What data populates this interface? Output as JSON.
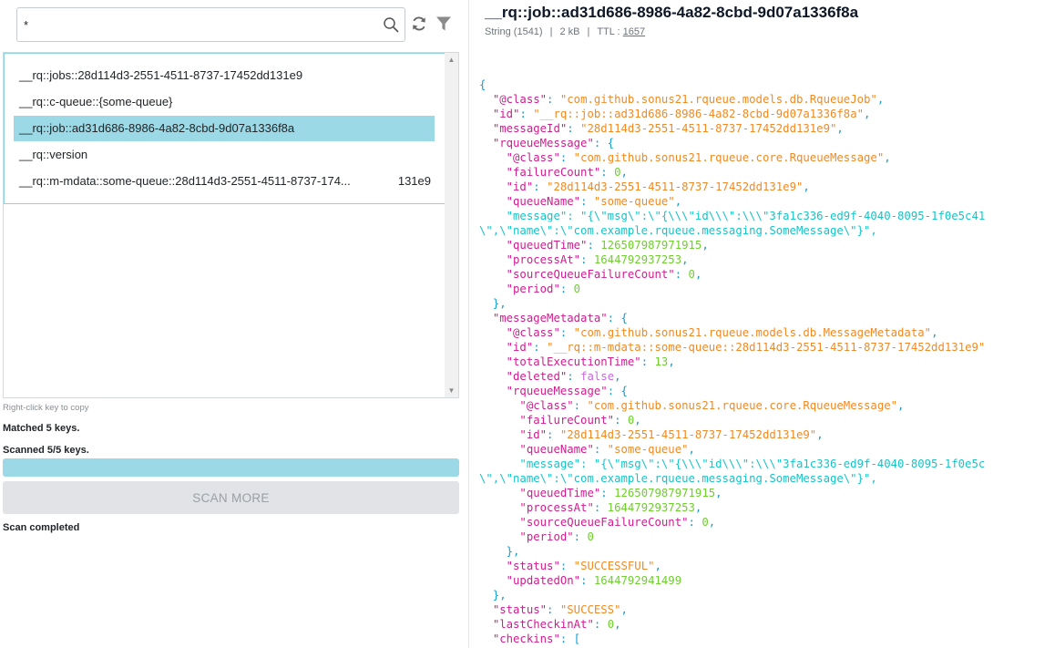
{
  "search": {
    "value": "*"
  },
  "keys": [
    {
      "label": "__rq::jobs::28d114d3-2551-4511-8737-17452dd131e9",
      "tail": "",
      "selected": false
    },
    {
      "label": "__rq::c-queue::{some-queue}",
      "tail": "",
      "selected": false
    },
    {
      "label": "__rq::job::ad31d686-8986-4a82-8cbd-9d07a1336f8a",
      "tail": "",
      "selected": true
    },
    {
      "label": "__rq::version",
      "tail": "",
      "selected": false
    },
    {
      "label": "__rq::m-mdata::some-queue::28d114d3-2551-4511-8737-174...",
      "tail": "131e9",
      "selected": false
    }
  ],
  "hint": "Right-click key to copy",
  "matched": "Matched 5 keys.",
  "scanned": "Scanned 5/5 keys.",
  "progress_percent": 100,
  "scan_more_label": "SCAN MORE",
  "scan_status": "Scan completed",
  "colors": {
    "accent": "#9ad9e5",
    "key": "#cf1d8f",
    "string": "#f08a24",
    "number": "#6fcf2e",
    "boolean": "#c76ae0",
    "punctuation": "#0e9fd1"
  },
  "detail": {
    "title": "__rq::job::ad31d686-8986-4a82-8cbd-9d07a1336f8a",
    "type": "String (1541)",
    "size": "2 kB",
    "ttl_label": "TTL :",
    "ttl_value": "1657"
  },
  "json_lines": [
    [
      [
        "p",
        "{"
      ]
    ],
    [
      [
        "p",
        "  "
      ],
      [
        "k",
        "\"@class\""
      ],
      [
        "p",
        ": "
      ],
      [
        "s",
        "\"com.github.sonus21.rqueue.models.db.RqueueJob\""
      ],
      [
        "p",
        ","
      ]
    ],
    [
      [
        "p",
        "  "
      ],
      [
        "k",
        "\"id\""
      ],
      [
        "p",
        ": "
      ],
      [
        "s",
        "\"__rq::job::ad31d686-8986-4a82-8cbd-9d07a1336f8a\""
      ],
      [
        "p",
        ","
      ]
    ],
    [
      [
        "p",
        "  "
      ],
      [
        "k",
        "\"messageId\""
      ],
      [
        "p",
        ": "
      ],
      [
        "s",
        "\"28d114d3-2551-4511-8737-17452dd131e9\""
      ],
      [
        "p",
        ","
      ]
    ],
    [
      [
        "p",
        "  "
      ],
      [
        "k",
        "\"rqueueMessage\""
      ],
      [
        "p",
        ": {"
      ]
    ],
    [
      [
        "p",
        "    "
      ],
      [
        "k",
        "\"@class\""
      ],
      [
        "p",
        ": "
      ],
      [
        "s",
        "\"com.github.sonus21.rqueue.core.RqueueMessage\""
      ],
      [
        "p",
        ","
      ]
    ],
    [
      [
        "p",
        "    "
      ],
      [
        "k",
        "\"failureCount\""
      ],
      [
        "p",
        ": "
      ],
      [
        "n",
        "0"
      ],
      [
        "p",
        ","
      ]
    ],
    [
      [
        "p",
        "    "
      ],
      [
        "k",
        "\"id\""
      ],
      [
        "p",
        ": "
      ],
      [
        "s",
        "\"28d114d3-2551-4511-8737-17452dd131e9\""
      ],
      [
        "p",
        ","
      ]
    ],
    [
      [
        "p",
        "    "
      ],
      [
        "k",
        "\"queueName\""
      ],
      [
        "p",
        ": "
      ],
      [
        "s",
        "\"some-queue\""
      ],
      [
        "p",
        ","
      ]
    ],
    [
      [
        "p",
        "    "
      ],
      [
        "e",
        "\"message\": \"{\\\"msg\\\":\\\"{\\\\\\\"id\\\\\\\":\\\\\\\"3fa1c336-ed9f-4040-8095-1f0e5c41"
      ]
    ],
    [
      [
        "e",
        "\\\",\\\"name\\\":\\\"com.example.rqueue.messaging.SomeMessage\\\"}\","
      ]
    ],
    [
      [
        "p",
        "    "
      ],
      [
        "k",
        "\"queuedTime\""
      ],
      [
        "p",
        ": "
      ],
      [
        "n",
        "126507987971915"
      ],
      [
        "p",
        ","
      ]
    ],
    [
      [
        "p",
        "    "
      ],
      [
        "k",
        "\"processAt\""
      ],
      [
        "p",
        ": "
      ],
      [
        "n",
        "1644792937253"
      ],
      [
        "p",
        ","
      ]
    ],
    [
      [
        "p",
        "    "
      ],
      [
        "k",
        "\"sourceQueueFailureCount\""
      ],
      [
        "p",
        ": "
      ],
      [
        "n",
        "0"
      ],
      [
        "p",
        ","
      ]
    ],
    [
      [
        "p",
        "    "
      ],
      [
        "k",
        "\"period\""
      ],
      [
        "p",
        ": "
      ],
      [
        "n",
        "0"
      ]
    ],
    [
      [
        "p",
        "  },"
      ]
    ],
    [
      [
        "p",
        "  "
      ],
      [
        "k",
        "\"messageMetadata\""
      ],
      [
        "p",
        ": {"
      ]
    ],
    [
      [
        "p",
        "    "
      ],
      [
        "k",
        "\"@class\""
      ],
      [
        "p",
        ": "
      ],
      [
        "s",
        "\"com.github.sonus21.rqueue.models.db.MessageMetadata\""
      ],
      [
        "p",
        ","
      ]
    ],
    [
      [
        "p",
        "    "
      ],
      [
        "k",
        "\"id\""
      ],
      [
        "p",
        ": "
      ],
      [
        "s",
        "\"__rq::m-mdata::some-queue::28d114d3-2551-4511-8737-17452dd131e9\""
      ]
    ],
    [
      [
        "p",
        "    "
      ],
      [
        "k",
        "\"totalExecutionTime\""
      ],
      [
        "p",
        ": "
      ],
      [
        "n",
        "13"
      ],
      [
        "p",
        ","
      ]
    ],
    [
      [
        "p",
        "    "
      ],
      [
        "k",
        "\"deleted\""
      ],
      [
        "p",
        ": "
      ],
      [
        "b",
        "false"
      ],
      [
        "p",
        ","
      ]
    ],
    [
      [
        "p",
        "    "
      ],
      [
        "k",
        "\"rqueueMessage\""
      ],
      [
        "p",
        ": {"
      ]
    ],
    [
      [
        "p",
        "      "
      ],
      [
        "k",
        "\"@class\""
      ],
      [
        "p",
        ": "
      ],
      [
        "s",
        "\"com.github.sonus21.rqueue.core.RqueueMessage\""
      ],
      [
        "p",
        ","
      ]
    ],
    [
      [
        "p",
        "      "
      ],
      [
        "k",
        "\"failureCount\""
      ],
      [
        "p",
        ": "
      ],
      [
        "n",
        "0"
      ],
      [
        "p",
        ","
      ]
    ],
    [
      [
        "p",
        "      "
      ],
      [
        "k",
        "\"id\""
      ],
      [
        "p",
        ": "
      ],
      [
        "s",
        "\"28d114d3-2551-4511-8737-17452dd131e9\""
      ],
      [
        "p",
        ","
      ]
    ],
    [
      [
        "p",
        "      "
      ],
      [
        "k",
        "\"queueName\""
      ],
      [
        "p",
        ": "
      ],
      [
        "s",
        "\"some-queue\""
      ],
      [
        "p",
        ","
      ]
    ],
    [
      [
        "p",
        "      "
      ],
      [
        "e",
        "\"message\": \"{\\\"msg\\\":\\\"{\\\\\\\"id\\\\\\\":\\\\\\\"3fa1c336-ed9f-4040-8095-1f0e5c"
      ]
    ],
    [
      [
        "e",
        "\\\",\\\"name\\\":\\\"com.example.rqueue.messaging.SomeMessage\\\"}\","
      ]
    ],
    [
      [
        "p",
        "      "
      ],
      [
        "k",
        "\"queuedTime\""
      ],
      [
        "p",
        ": "
      ],
      [
        "n",
        "126507987971915"
      ],
      [
        "p",
        ","
      ]
    ],
    [
      [
        "p",
        "      "
      ],
      [
        "k",
        "\"processAt\""
      ],
      [
        "p",
        ": "
      ],
      [
        "n",
        "1644792937253"
      ],
      [
        "p",
        ","
      ]
    ],
    [
      [
        "p",
        "      "
      ],
      [
        "k",
        "\"sourceQueueFailureCount\""
      ],
      [
        "p",
        ": "
      ],
      [
        "n",
        "0"
      ],
      [
        "p",
        ","
      ]
    ],
    [
      [
        "p",
        "      "
      ],
      [
        "k",
        "\"period\""
      ],
      [
        "p",
        ": "
      ],
      [
        "n",
        "0"
      ]
    ],
    [
      [
        "p",
        "    },"
      ]
    ],
    [
      [
        "p",
        "    "
      ],
      [
        "k",
        "\"status\""
      ],
      [
        "p",
        ": "
      ],
      [
        "s",
        "\"SUCCESSFUL\""
      ],
      [
        "p",
        ","
      ]
    ],
    [
      [
        "p",
        "    "
      ],
      [
        "k",
        "\"updatedOn\""
      ],
      [
        "p",
        ": "
      ],
      [
        "n",
        "1644792941499"
      ]
    ],
    [
      [
        "p",
        "  },"
      ]
    ],
    [
      [
        "p",
        "  "
      ],
      [
        "k",
        "\"status\""
      ],
      [
        "p",
        ": "
      ],
      [
        "s",
        "\"SUCCESS\""
      ],
      [
        "p",
        ","
      ]
    ],
    [
      [
        "p",
        "  "
      ],
      [
        "k",
        "\"lastCheckinAt\""
      ],
      [
        "p",
        ": "
      ],
      [
        "n",
        "0"
      ],
      [
        "p",
        ","
      ]
    ],
    [
      [
        "p",
        "  "
      ],
      [
        "k",
        "\"checkins\""
      ],
      [
        "p",
        ": ["
      ]
    ]
  ]
}
